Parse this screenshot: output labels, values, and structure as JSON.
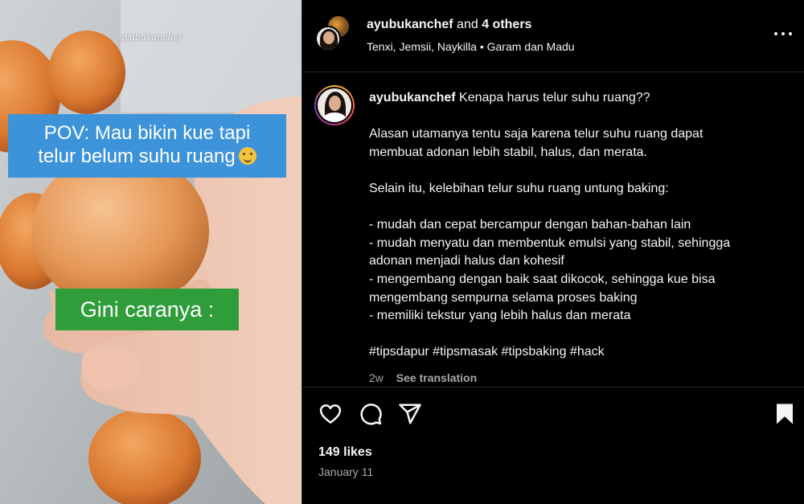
{
  "media": {
    "watermark": "ayubukanchef",
    "caption_top_line1": "POV: Mau bikin kue tapi",
    "caption_top_line2": "telur belum suhu ruang",
    "caption_bottom": "Gini caranya :"
  },
  "header": {
    "username": "ayubukanchef",
    "and_text": "and",
    "others": "4 others",
    "collaborators": "Tenxi, Jemsii, Naykilla",
    "separator": "•",
    "audio": "Garam dan Madu",
    "more_icon": "more-horizontal-icon"
  },
  "caption": {
    "username": "ayubukanchef",
    "lines": [
      "Kenapa harus telur suhu ruang??",
      "",
      "Alasan utamanya tentu saja karena telur suhu ruang dapat",
      "membuat adonan lebih stabil, halus, dan merata.",
      "",
      "Selain itu, kelebihan telur suhu ruang untung baking:",
      "",
      "- mudah dan cepat bercampur dengan bahan-bahan lain",
      "- mudah menyatu dan membentuk emulsi yang stabil, sehingga",
      "adonan menjadi halus dan kohesif",
      "- mengembang dengan baik saat dikocok, sehingga kue bisa",
      "mengembang sempurna selama proses baking",
      "- memiliki tekstur yang lebih halus dan merata",
      "",
      "#tipsdapur #tipsmasak #tipsbaking #hack"
    ],
    "time_ago": "2w",
    "see_translation": "See translation"
  },
  "actions": {
    "icons": [
      "heart-icon",
      "comment-icon",
      "share-icon",
      "bookmark-icon"
    ],
    "likes": "149 likes",
    "date": "January 11"
  }
}
